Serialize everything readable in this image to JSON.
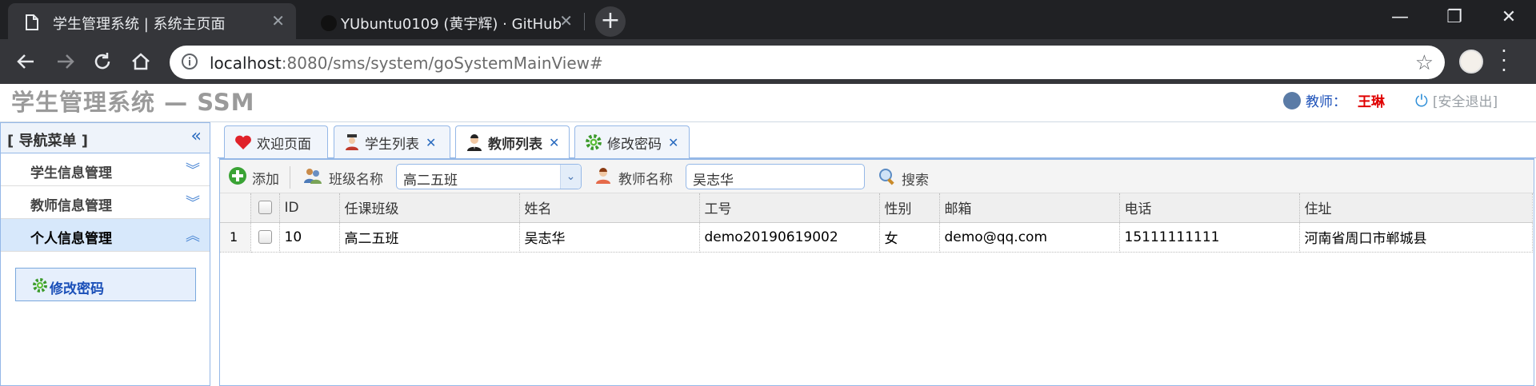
{
  "browser": {
    "tabs": [
      {
        "title": "学生管理系统 | 系统主页面",
        "icon": "page-icon",
        "active": true
      },
      {
        "title": "YUbuntu0109 (黄宇辉) · GitHub",
        "icon": "github-icon",
        "active": false
      }
    ],
    "url_host": "localhost",
    "url_rest": ":8080/sms/system/goSystemMainView#"
  },
  "header": {
    "app_title": "学生管理系统 — SSM",
    "role_label": "教师：",
    "user_name": "王琳",
    "logout_label": "[安全退出]"
  },
  "sidebar": {
    "title": "[ 导航菜单 ]",
    "items": [
      {
        "label": "学生信息管理",
        "expanded": false
      },
      {
        "label": "教师信息管理",
        "expanded": false
      },
      {
        "label": "个人信息管理",
        "expanded": true
      }
    ],
    "sub_item": "修改密码"
  },
  "tabs": [
    {
      "label": "欢迎页面",
      "icon": "heart-icon",
      "closable": false,
      "selected": false
    },
    {
      "label": "学生列表",
      "icon": "student-icon",
      "closable": true,
      "selected": false
    },
    {
      "label": "教师列表",
      "icon": "teacher-icon",
      "closable": true,
      "selected": true
    },
    {
      "label": "修改密码",
      "icon": "gear-icon",
      "closable": true,
      "selected": false
    }
  ],
  "toolbar": {
    "add_label": "添加",
    "class_label": "班级名称",
    "class_value": "高二五班",
    "teacher_label": "教师名称",
    "teacher_value": "吴志华",
    "search_label": "搜索"
  },
  "table": {
    "columns": [
      "ID",
      "任课班级",
      "姓名",
      "工号",
      "性别",
      "邮箱",
      "电话",
      "住址"
    ],
    "rows": [
      {
        "rownum": "1",
        "id": "10",
        "class": "高二五班",
        "name": "吴志华",
        "job_no": "demo20190619002",
        "gender": "女",
        "email": "demo@qq.com",
        "phone": "15111111111",
        "address": "河南省周口市郸城县"
      }
    ]
  }
}
